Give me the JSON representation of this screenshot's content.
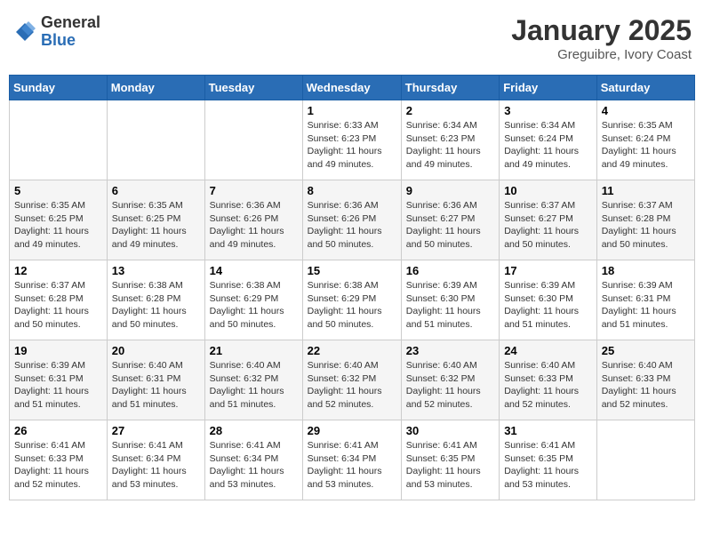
{
  "header": {
    "logo_general": "General",
    "logo_blue": "Blue",
    "month_title": "January 2025",
    "location": "Greguibre, Ivory Coast"
  },
  "days_of_week": [
    "Sunday",
    "Monday",
    "Tuesday",
    "Wednesday",
    "Thursday",
    "Friday",
    "Saturday"
  ],
  "weeks": [
    [
      {
        "day": "",
        "sunrise": "",
        "sunset": "",
        "daylight": ""
      },
      {
        "day": "",
        "sunrise": "",
        "sunset": "",
        "daylight": ""
      },
      {
        "day": "",
        "sunrise": "",
        "sunset": "",
        "daylight": ""
      },
      {
        "day": "1",
        "sunrise": "Sunrise: 6:33 AM",
        "sunset": "Sunset: 6:23 PM",
        "daylight": "Daylight: 11 hours and 49 minutes."
      },
      {
        "day": "2",
        "sunrise": "Sunrise: 6:34 AM",
        "sunset": "Sunset: 6:23 PM",
        "daylight": "Daylight: 11 hours and 49 minutes."
      },
      {
        "day": "3",
        "sunrise": "Sunrise: 6:34 AM",
        "sunset": "Sunset: 6:24 PM",
        "daylight": "Daylight: 11 hours and 49 minutes."
      },
      {
        "day": "4",
        "sunrise": "Sunrise: 6:35 AM",
        "sunset": "Sunset: 6:24 PM",
        "daylight": "Daylight: 11 hours and 49 minutes."
      }
    ],
    [
      {
        "day": "5",
        "sunrise": "Sunrise: 6:35 AM",
        "sunset": "Sunset: 6:25 PM",
        "daylight": "Daylight: 11 hours and 49 minutes."
      },
      {
        "day": "6",
        "sunrise": "Sunrise: 6:35 AM",
        "sunset": "Sunset: 6:25 PM",
        "daylight": "Daylight: 11 hours and 49 minutes."
      },
      {
        "day": "7",
        "sunrise": "Sunrise: 6:36 AM",
        "sunset": "Sunset: 6:26 PM",
        "daylight": "Daylight: 11 hours and 49 minutes."
      },
      {
        "day": "8",
        "sunrise": "Sunrise: 6:36 AM",
        "sunset": "Sunset: 6:26 PM",
        "daylight": "Daylight: 11 hours and 50 minutes."
      },
      {
        "day": "9",
        "sunrise": "Sunrise: 6:36 AM",
        "sunset": "Sunset: 6:27 PM",
        "daylight": "Daylight: 11 hours and 50 minutes."
      },
      {
        "day": "10",
        "sunrise": "Sunrise: 6:37 AM",
        "sunset": "Sunset: 6:27 PM",
        "daylight": "Daylight: 11 hours and 50 minutes."
      },
      {
        "day": "11",
        "sunrise": "Sunrise: 6:37 AM",
        "sunset": "Sunset: 6:28 PM",
        "daylight": "Daylight: 11 hours and 50 minutes."
      }
    ],
    [
      {
        "day": "12",
        "sunrise": "Sunrise: 6:37 AM",
        "sunset": "Sunset: 6:28 PM",
        "daylight": "Daylight: 11 hours and 50 minutes."
      },
      {
        "day": "13",
        "sunrise": "Sunrise: 6:38 AM",
        "sunset": "Sunset: 6:28 PM",
        "daylight": "Daylight: 11 hours and 50 minutes."
      },
      {
        "day": "14",
        "sunrise": "Sunrise: 6:38 AM",
        "sunset": "Sunset: 6:29 PM",
        "daylight": "Daylight: 11 hours and 50 minutes."
      },
      {
        "day": "15",
        "sunrise": "Sunrise: 6:38 AM",
        "sunset": "Sunset: 6:29 PM",
        "daylight": "Daylight: 11 hours and 50 minutes."
      },
      {
        "day": "16",
        "sunrise": "Sunrise: 6:39 AM",
        "sunset": "Sunset: 6:30 PM",
        "daylight": "Daylight: 11 hours and 51 minutes."
      },
      {
        "day": "17",
        "sunrise": "Sunrise: 6:39 AM",
        "sunset": "Sunset: 6:30 PM",
        "daylight": "Daylight: 11 hours and 51 minutes."
      },
      {
        "day": "18",
        "sunrise": "Sunrise: 6:39 AM",
        "sunset": "Sunset: 6:31 PM",
        "daylight": "Daylight: 11 hours and 51 minutes."
      }
    ],
    [
      {
        "day": "19",
        "sunrise": "Sunrise: 6:39 AM",
        "sunset": "Sunset: 6:31 PM",
        "daylight": "Daylight: 11 hours and 51 minutes."
      },
      {
        "day": "20",
        "sunrise": "Sunrise: 6:40 AM",
        "sunset": "Sunset: 6:31 PM",
        "daylight": "Daylight: 11 hours and 51 minutes."
      },
      {
        "day": "21",
        "sunrise": "Sunrise: 6:40 AM",
        "sunset": "Sunset: 6:32 PM",
        "daylight": "Daylight: 11 hours and 51 minutes."
      },
      {
        "day": "22",
        "sunrise": "Sunrise: 6:40 AM",
        "sunset": "Sunset: 6:32 PM",
        "daylight": "Daylight: 11 hours and 52 minutes."
      },
      {
        "day": "23",
        "sunrise": "Sunrise: 6:40 AM",
        "sunset": "Sunset: 6:32 PM",
        "daylight": "Daylight: 11 hours and 52 minutes."
      },
      {
        "day": "24",
        "sunrise": "Sunrise: 6:40 AM",
        "sunset": "Sunset: 6:33 PM",
        "daylight": "Daylight: 11 hours and 52 minutes."
      },
      {
        "day": "25",
        "sunrise": "Sunrise: 6:40 AM",
        "sunset": "Sunset: 6:33 PM",
        "daylight": "Daylight: 11 hours and 52 minutes."
      }
    ],
    [
      {
        "day": "26",
        "sunrise": "Sunrise: 6:41 AM",
        "sunset": "Sunset: 6:33 PM",
        "daylight": "Daylight: 11 hours and 52 minutes."
      },
      {
        "day": "27",
        "sunrise": "Sunrise: 6:41 AM",
        "sunset": "Sunset: 6:34 PM",
        "daylight": "Daylight: 11 hours and 53 minutes."
      },
      {
        "day": "28",
        "sunrise": "Sunrise: 6:41 AM",
        "sunset": "Sunset: 6:34 PM",
        "daylight": "Daylight: 11 hours and 53 minutes."
      },
      {
        "day": "29",
        "sunrise": "Sunrise: 6:41 AM",
        "sunset": "Sunset: 6:34 PM",
        "daylight": "Daylight: 11 hours and 53 minutes."
      },
      {
        "day": "30",
        "sunrise": "Sunrise: 6:41 AM",
        "sunset": "Sunset: 6:35 PM",
        "daylight": "Daylight: 11 hours and 53 minutes."
      },
      {
        "day": "31",
        "sunrise": "Sunrise: 6:41 AM",
        "sunset": "Sunset: 6:35 PM",
        "daylight": "Daylight: 11 hours and 53 minutes."
      },
      {
        "day": "",
        "sunrise": "",
        "sunset": "",
        "daylight": ""
      }
    ]
  ]
}
